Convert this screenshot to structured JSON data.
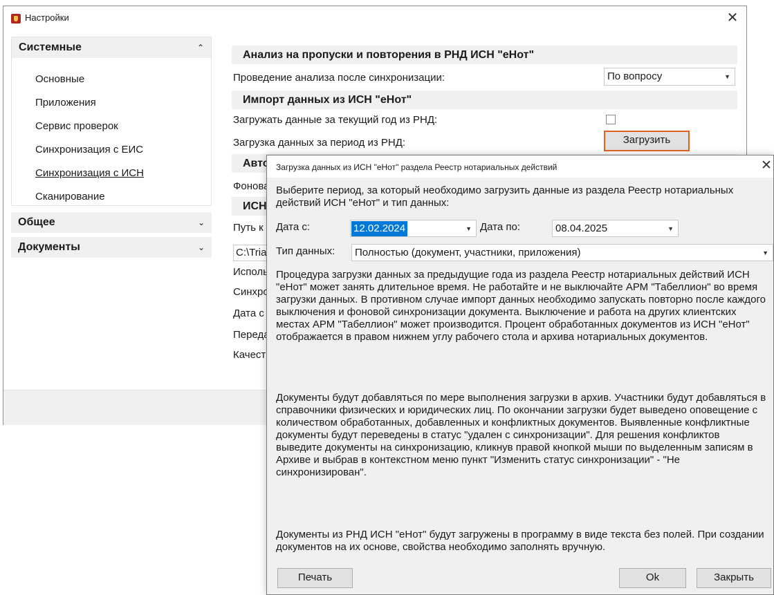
{
  "main_window": {
    "title": "Настройки",
    "sidebar": {
      "header": "Системные",
      "items": [
        {
          "label": "Основные"
        },
        {
          "label": "Приложения"
        },
        {
          "label": "Сервис проверок"
        },
        {
          "label": "Синхронизация с ЕИС"
        },
        {
          "label": "Синхронизация с ИСН",
          "active": true
        },
        {
          "label": "Сканирование"
        }
      ],
      "groups": [
        {
          "label": "Общее"
        },
        {
          "label": "Документы"
        }
      ]
    },
    "content": {
      "section1": {
        "title": "Анализ на пропуски и повторения в РНД ИСН \"еНот\"",
        "analysis_label": "Проведение анализа после синхронизации:",
        "analysis_value": "По вопросу"
      },
      "section2": {
        "title": "Импорт данных из ИСН \"еНот\"",
        "current_year_label": "Загружать данные за текущий год из РНД:",
        "current_year_checked": false,
        "period_label": "Загрузка данных за период из РНД:",
        "load_button": "Загрузить"
      },
      "section3_partial": "Авто",
      "row_fon_partial": "Фонова",
      "section4_partial": "ИСН",
      "path_label_partial": "Путь к",
      "path_value_partial": "C:\\Tria",
      "row_ispol_partial": "Исполь",
      "row_sinh_partial": "Синхро",
      "row_data_partial": "Дата с",
      "row_pered_partial": "Переда",
      "row_kach_partial": "Качест"
    }
  },
  "dialog": {
    "title": "Загрузка данных из ИСН \"еНот\" раздела Реестр нотариальных действий",
    "intro": "Выберите период, за который необходимо загрузить данные из раздела Реестр нотариальных действий ИСН \"еНот\" и тип данных:",
    "date_from_label": "Дата с:",
    "date_from": "12.02.2024",
    "date_to_label": "Дата по:",
    "date_to": "08.04.2025",
    "data_type_label": "Тип данных:",
    "data_type_value": "Полностью (документ, участники, приложения)",
    "paragraph1": "Процедура загрузки данных за предыдущие года из раздела Реестр нотариальных действий ИСН \"еНот\" может занять длительное время. Не работайте и не выключайте АРМ \"Табеллион\" во время загрузки данных. В противном случае импорт данных необходимо запускать повторно после каждого выключения и фоновой синхронизации документа. Выключение и работа на других клиентских местах АРМ \"Табеллион\" может производится. Процент обработанных документов из ИСН \"еНот\" отображается в правом нижнем углу рабочего стола и архива нотариальных документов.",
    "paragraph2": "Документы будут добавляться по мере выполнения загрузки в архив. Участники будут добавляться в справочники физических и юридических лиц. По окончании загрузки будет выведено оповещение с количеством обработанных, добавленных и конфликтных документов. Выявленные конфликтные документы будут переведены в статус \"удален с синхронизации\". Для решения конфликтов выведите документы на синхронизацию, кликнув правой кнопкой мыши по выделенным записям в Архиве и выбрав в контекстном меню пункт \"Изменить статус синхронизации\" - \"Не синхронизирован\".",
    "paragraph3": "Документы из РНД ИСН \"еНот\" будут загружены в программу в виде текста без полей. При создании документов на их основе, свойства необходимо заполнять вручную.",
    "buttons": {
      "print": "Печать",
      "ok": "Ok",
      "close": "Закрыть"
    }
  },
  "colors": {
    "accent_focus": "#e0601f",
    "selection": "#0078d7",
    "header_bg": "#f0f0f0"
  }
}
